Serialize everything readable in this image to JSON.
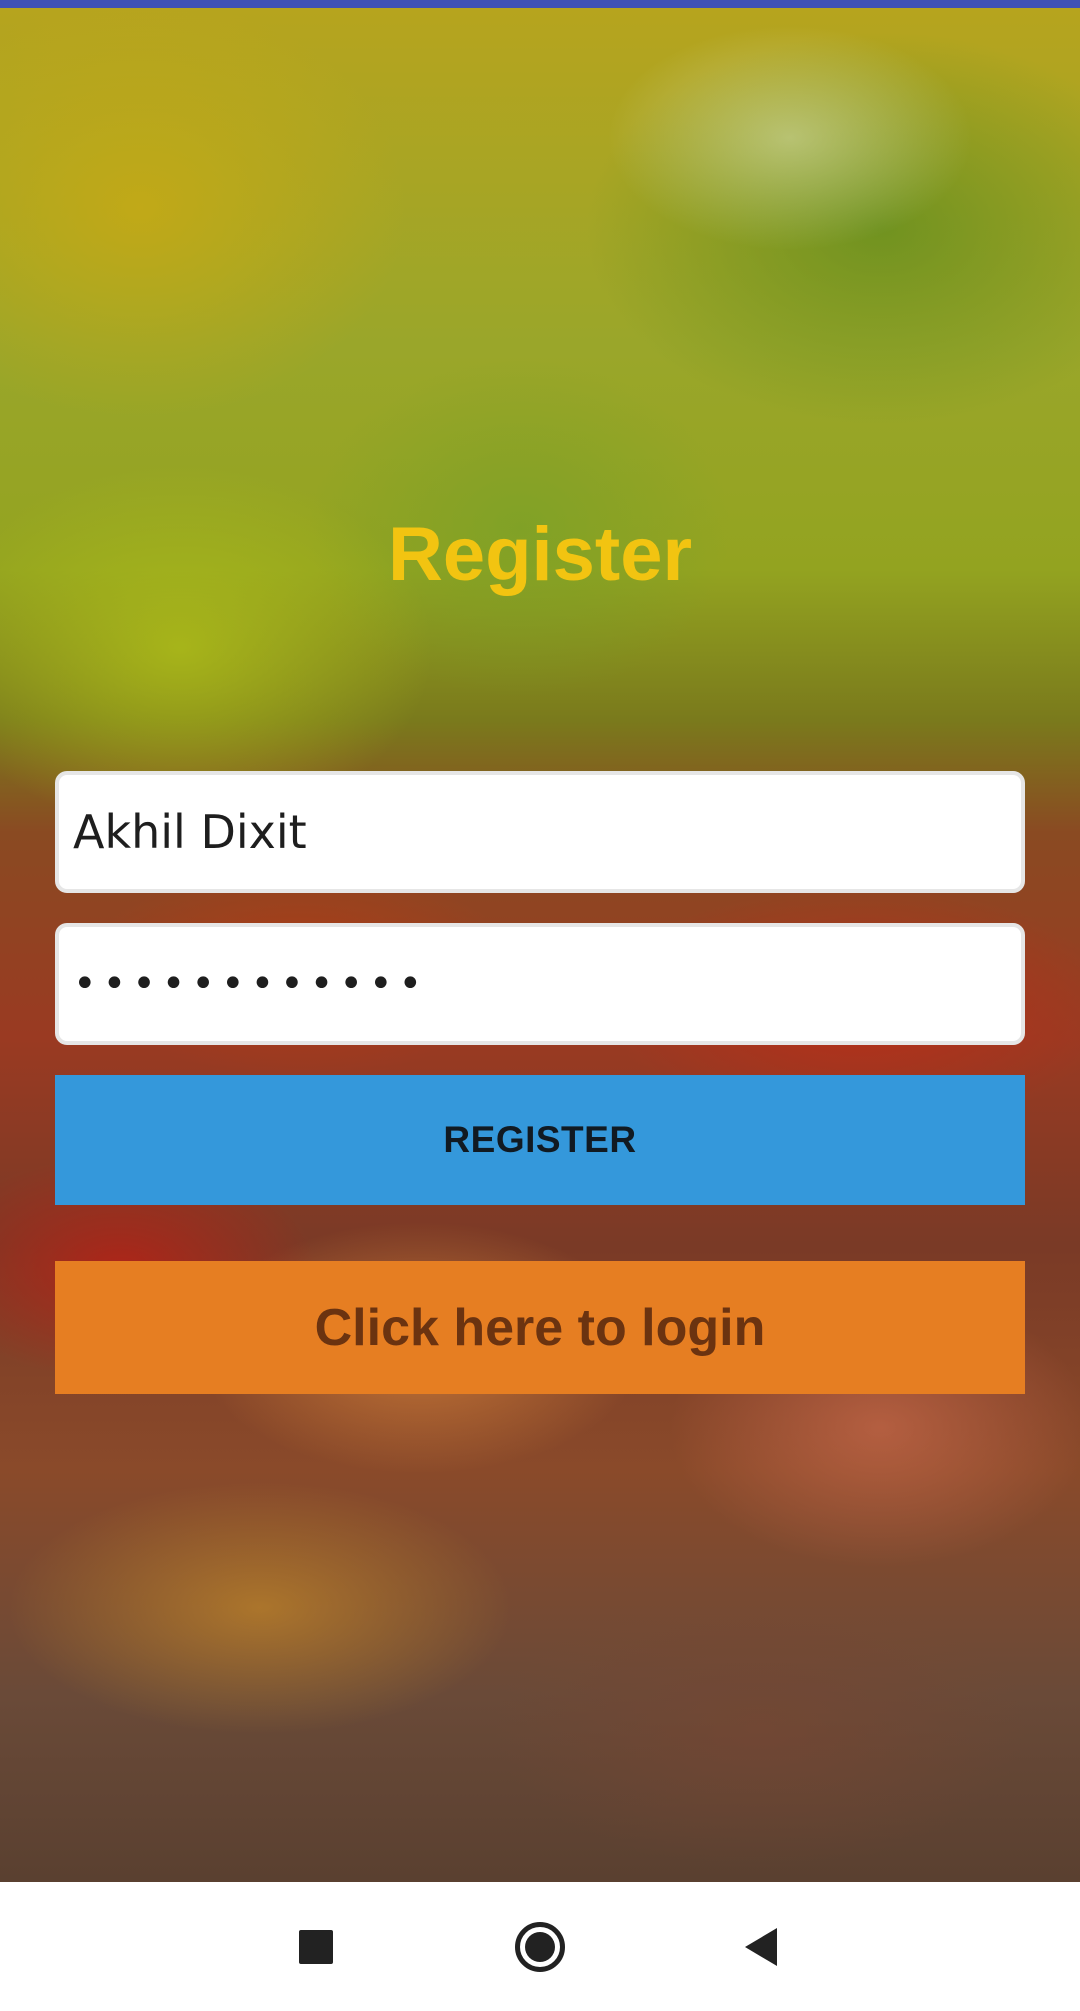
{
  "screen": {
    "title": "Register"
  },
  "form": {
    "name_value": "Akhil Dixit",
    "password_value": "••••••••••••"
  },
  "buttons": {
    "register_label": "REGISTER",
    "login_label": "Click here to login"
  },
  "nav_bar": {
    "recents_icon": "square-icon",
    "home_icon": "circle-icon",
    "back_icon": "triangle-back-icon"
  },
  "colors": {
    "status_strip": "#3f51b5",
    "title": "#f2c411",
    "register_button": "#3498db",
    "login_button": "#e67e22",
    "login_text": "#6b3310"
  }
}
